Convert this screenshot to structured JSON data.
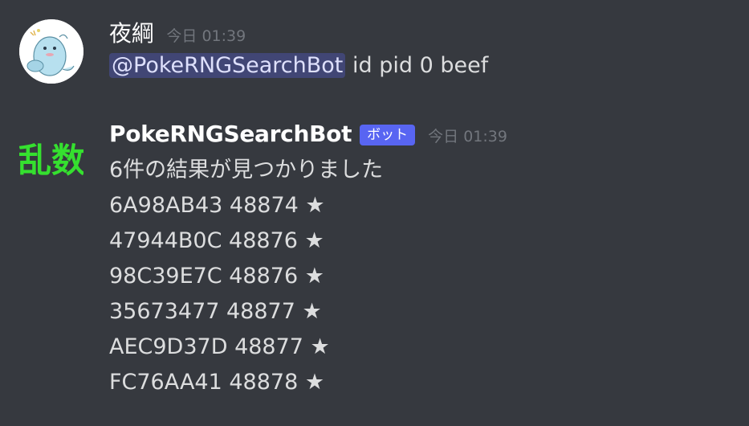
{
  "messages": [
    {
      "author": "夜綱",
      "timestamp": "今日 01:39",
      "mention": "@PokeRNGSearchBot",
      "text": " id pid 0 beef",
      "avatar_icon": "character-avatar-icon"
    },
    {
      "author": "PokeRNGSearchBot",
      "bot_tag": "ボット",
      "timestamp": "今日 01:39",
      "avatar_text": "乱数",
      "avatar_color": "#35e02f",
      "summary": "6件の結果が見つかりました",
      "results": [
        "6A98AB43 48874 ★",
        "47944B0C 48876 ★",
        "98C39E7C 48876 ★",
        "35673477 48877 ★",
        "AEC9D37D 48877 ★",
        "FC76AA41 48878 ★"
      ]
    }
  ],
  "colors": {
    "background": "#36393f",
    "mention_bg": "#414675",
    "bot_tag_bg": "#5865f2",
    "timestamp": "#72767d"
  }
}
